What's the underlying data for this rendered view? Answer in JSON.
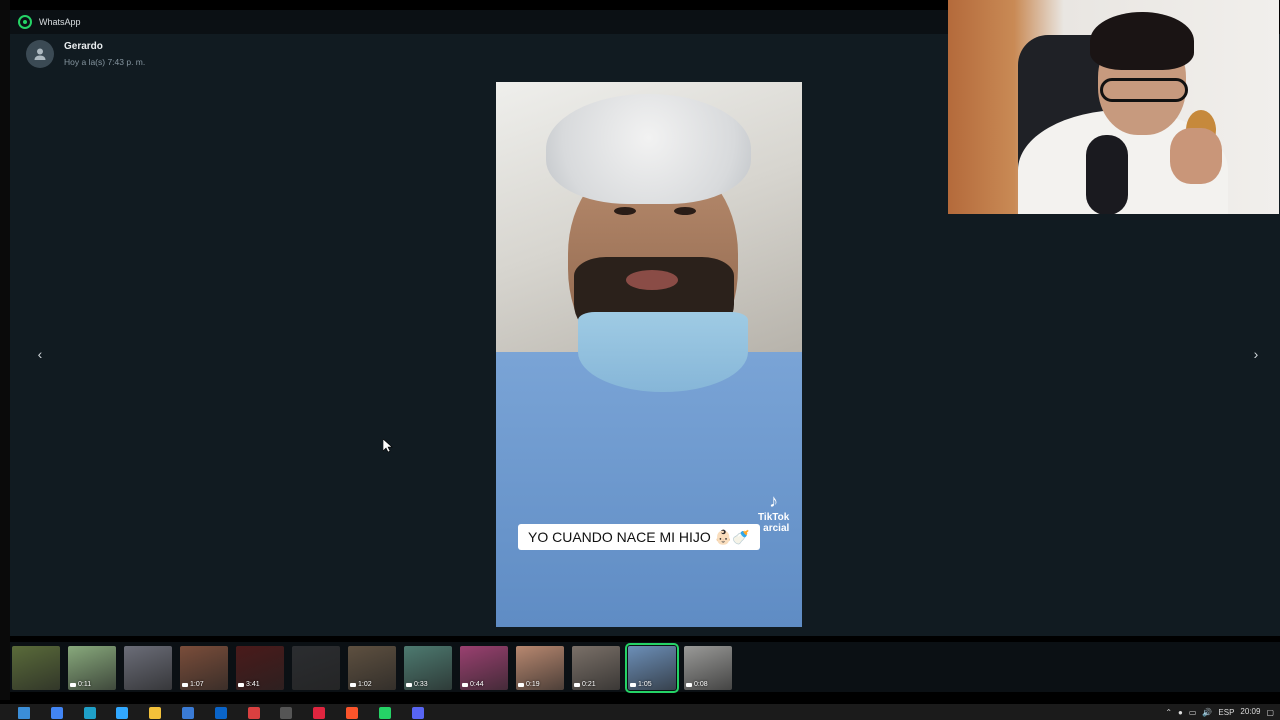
{
  "window": {
    "title": "WhatsApp"
  },
  "sender": {
    "name": "Gerardo",
    "timestamp": "Hoy a la(s) 7:43 p. m."
  },
  "nav": {
    "prev_icon": "‹",
    "next_icon": "›"
  },
  "media": {
    "caption": "YO CUANDO NACE MI HIJO 👶🏻🍼",
    "watermark_logo": "♪",
    "watermark_brand": "TikTok",
    "watermark_user": "arcial"
  },
  "thumbnails": [
    {
      "duration": "",
      "color": "#5a6b3a",
      "active": false
    },
    {
      "duration": "0:11",
      "color": "#88a97c",
      "active": false
    },
    {
      "duration": "",
      "color": "#6b6d78",
      "active": false
    },
    {
      "duration": "1:07",
      "color": "#7a4d3a",
      "active": false
    },
    {
      "duration": "3:41",
      "color": "#4a1a1a",
      "active": false
    },
    {
      "duration": "",
      "color": "#2b2d30",
      "active": false
    },
    {
      "duration": "1:02",
      "color": "#5e5040",
      "active": false
    },
    {
      "duration": "0:33",
      "color": "#4d7a70",
      "active": false
    },
    {
      "duration": "0:44",
      "color": "#9a4070",
      "active": false
    },
    {
      "duration": "0:19",
      "color": "#b88870",
      "active": false
    },
    {
      "duration": "0:21",
      "color": "#7a7068",
      "active": false
    },
    {
      "duration": "1:05",
      "color": "#6c8fb8",
      "active": true
    },
    {
      "duration": "0:08",
      "color": "#9a9a98",
      "active": false
    }
  ],
  "taskbar": {
    "language": "ESP",
    "time": "20:09",
    "icons": [
      {
        "name": "windows-start-icon",
        "color": "#3b8ed8"
      },
      {
        "name": "chrome-icon",
        "color": "#4285f4"
      },
      {
        "name": "edge-icon",
        "color": "#1fa0c8"
      },
      {
        "name": "photoshop-icon",
        "color": "#31a8ff"
      },
      {
        "name": "file-explorer-icon",
        "color": "#f3c13a"
      },
      {
        "name": "store-icon",
        "color": "#3a7bd5"
      },
      {
        "name": "outlook-icon",
        "color": "#0a64c8"
      },
      {
        "name": "calendar-icon",
        "color": "#d94040"
      },
      {
        "name": "obs-icon",
        "color": "#555555"
      },
      {
        "name": "opera-icon",
        "color": "#e0253f"
      },
      {
        "name": "brave-icon",
        "color": "#fb542b"
      },
      {
        "name": "whatsapp-icon",
        "color": "#25d366"
      },
      {
        "name": "discord-icon",
        "color": "#5865f2"
      }
    ]
  }
}
